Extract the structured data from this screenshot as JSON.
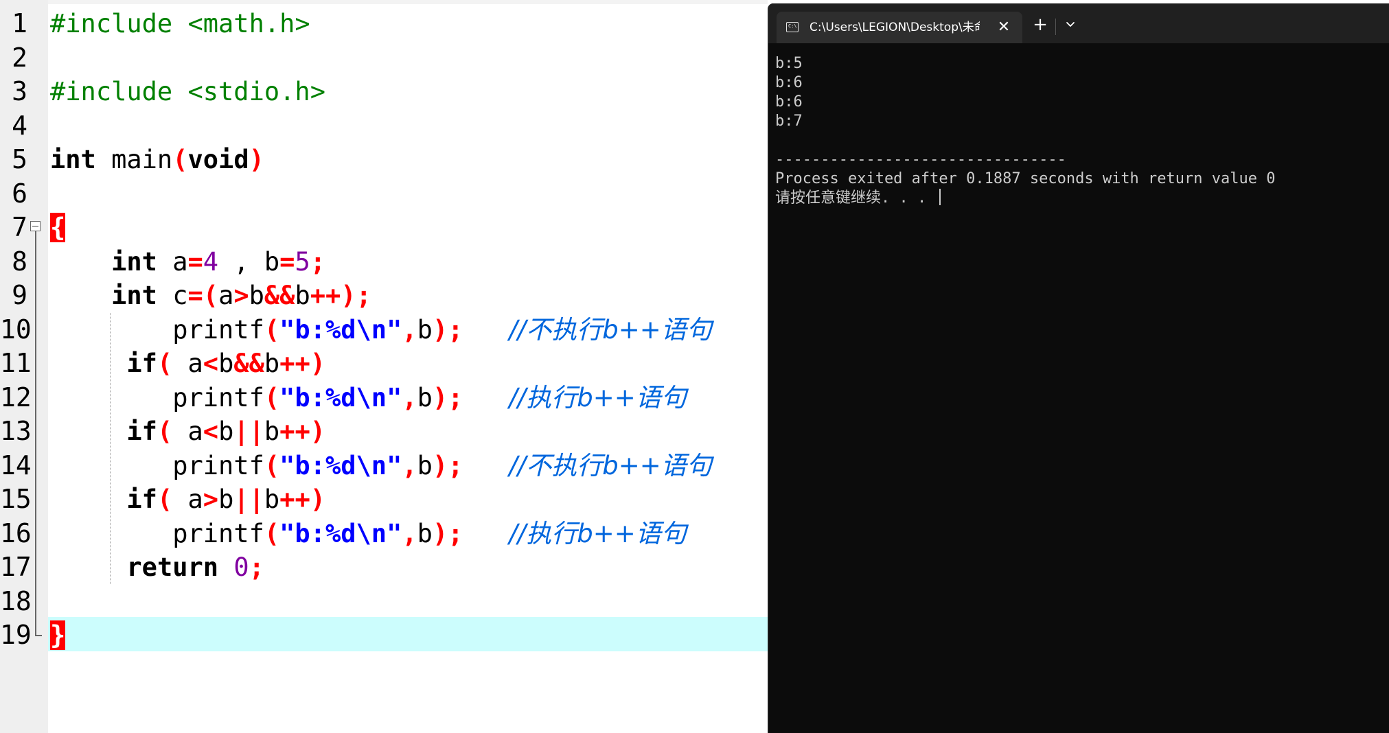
{
  "editor": {
    "line_numbers": [
      "1",
      "2",
      "3",
      "4",
      "5",
      "6",
      "7",
      "8",
      "9",
      "10",
      "11",
      "12",
      "13",
      "14",
      "15",
      "16",
      "17",
      "18",
      "19"
    ],
    "code": {
      "l1": "#include <math.h>",
      "l3": "#include <stdio.h>",
      "l5": {
        "kw_int": "int",
        "main": " main",
        "lp": "(",
        "kw_void": "void",
        "rp": ")"
      },
      "l7": {
        "brace": "{"
      },
      "l8": {
        "kw_int": "int",
        "a": " a",
        "eq": "=",
        "n4": "4",
        "mid": " , b",
        "eq2": "=",
        "n5": "5",
        "semi": ";"
      },
      "l9": {
        "kw_int": "int",
        "c": " c",
        "op1": "=(",
        "a": "a",
        "gt": ">",
        "b": "b",
        "and": "&&",
        "b2": "b",
        "op2": "++);"
      },
      "l10": {
        "fn": "printf",
        "lp": "(",
        "str": "\"b:%d\\n\"",
        "comma": ",",
        "b": "b",
        "rp": ");",
        "comment": "//不执行b++语句"
      },
      "l11": {
        "kw_if": "if",
        "lp": "( ",
        "a": "a",
        "lt": "<",
        "b": "b",
        "and": "&&",
        "b2": "b",
        "rp": "++)"
      },
      "l12": {
        "fn": "printf",
        "lp": "(",
        "str": "\"b:%d\\n\"",
        "comma": ",",
        "b": "b",
        "rp": ");",
        "comment": "//执行b++语句"
      },
      "l13": {
        "kw_if": "if",
        "lp": "( ",
        "a": "a",
        "lt": "<",
        "b": "b",
        "or": "||",
        "b2": "b",
        "rp": "++)"
      },
      "l14": {
        "fn": "printf",
        "lp": "(",
        "str": "\"b:%d\\n\"",
        "comma": ",",
        "b": "b",
        "rp": ");",
        "comment": "//不执行b++语句"
      },
      "l15": {
        "kw_if": "if",
        "lp": "( ",
        "a": "a",
        "gt": ">",
        "b": "b",
        "or": "||",
        "b2": "b",
        "rp": "++)"
      },
      "l16": {
        "fn": "printf",
        "lp": "(",
        "str": "\"b:%d\\n\"",
        "comma": ",",
        "b": "b",
        "rp": ");",
        "comment": "//执行b++语句"
      },
      "l17": {
        "kw_return": "return",
        "n0": "0",
        "semi": ";"
      },
      "l19": {
        "brace": "}"
      }
    }
  },
  "console": {
    "tab_icon": "C:\\",
    "tab_title": "C:\\Users\\LEGION\\Desktop\\未命",
    "close_icon": "close-icon",
    "new_tab_glyph": "+",
    "dropdown_icon": "chevron-down-icon",
    "lines": [
      "b:5",
      "b:6",
      "b:6",
      "b:7",
      "",
      "--------------------------------",
      "Process exited after 0.1887 seconds with return value 0",
      "请按任意键继续. . . "
    ]
  },
  "colors": {
    "preprocessor": "#008000",
    "number": "#8000a0",
    "operator": "#ff0000",
    "string": "#0000ff",
    "comment": "#0066dd",
    "current_line": "#ccfdfd",
    "console_bg": "#0c0c0c",
    "console_text": "#cccccc"
  }
}
